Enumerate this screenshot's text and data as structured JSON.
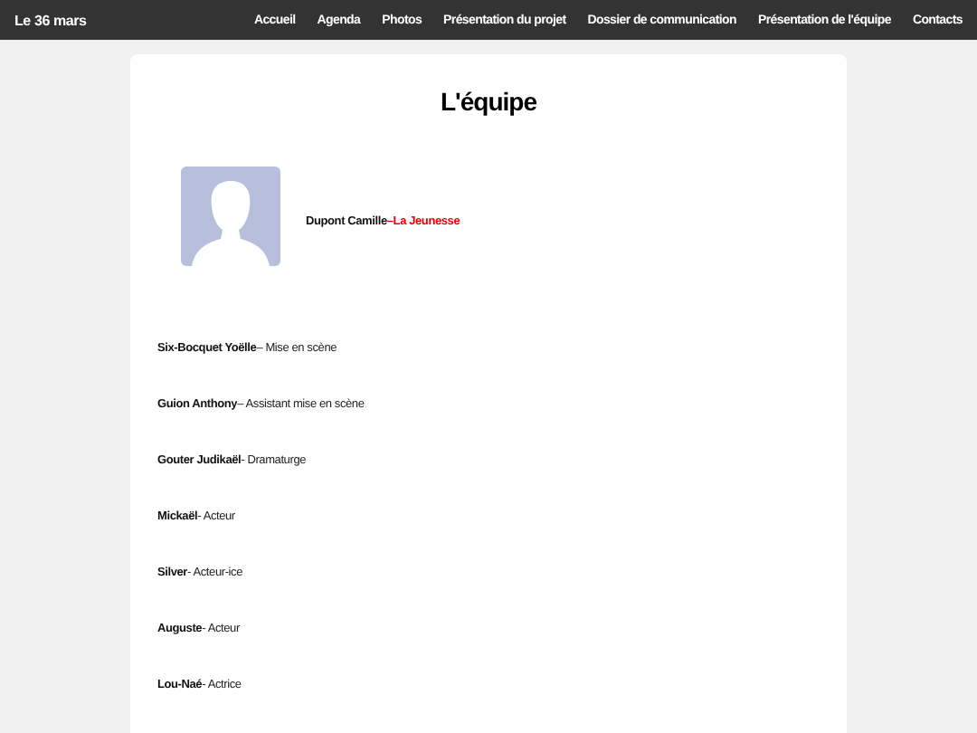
{
  "site_title": "Le 36 mars",
  "nav": [
    {
      "label": "Accueil",
      "selected": false
    },
    {
      "label": "Agenda",
      "selected": false
    },
    {
      "label": "Photos",
      "selected": false
    },
    {
      "label": "Présentation du projet",
      "selected": false
    },
    {
      "label": "Dossier de communication",
      "selected": false
    },
    {
      "label": "Présentation de l'équipe",
      "selected": false
    },
    {
      "label": "Contacts",
      "selected": false
    }
  ],
  "page_title": "L'équipe",
  "members": [
    {
      "kind": "featured",
      "name": "Dupont Camille",
      "separator": "–",
      "role": "La Jeunesse"
    },
    {
      "kind": "plain",
      "name": "Six-Bocquet Yoëlle",
      "separator": "– ",
      "role": "Mise en scène"
    },
    {
      "kind": "plain",
      "name": "Guion Anthony",
      "separator": "– ",
      "role": "Assistant mise en scène"
    },
    {
      "kind": "plain",
      "name": "Gouter Judikaël",
      "separator": "- ",
      "role": "Dramaturge"
    },
    {
      "kind": "plain",
      "name": "Mickaël",
      "separator": "- ",
      "role": "Acteur"
    },
    {
      "kind": "plain",
      "name": "Silver",
      "separator": "- ",
      "role": "Acteur-ice"
    },
    {
      "kind": "plain",
      "name": "Auguste",
      "separator": "- ",
      "role": "Acteur"
    },
    {
      "kind": "plain",
      "name": "Lou-Naé",
      "separator": "- ",
      "role": "Actrice"
    }
  ]
}
